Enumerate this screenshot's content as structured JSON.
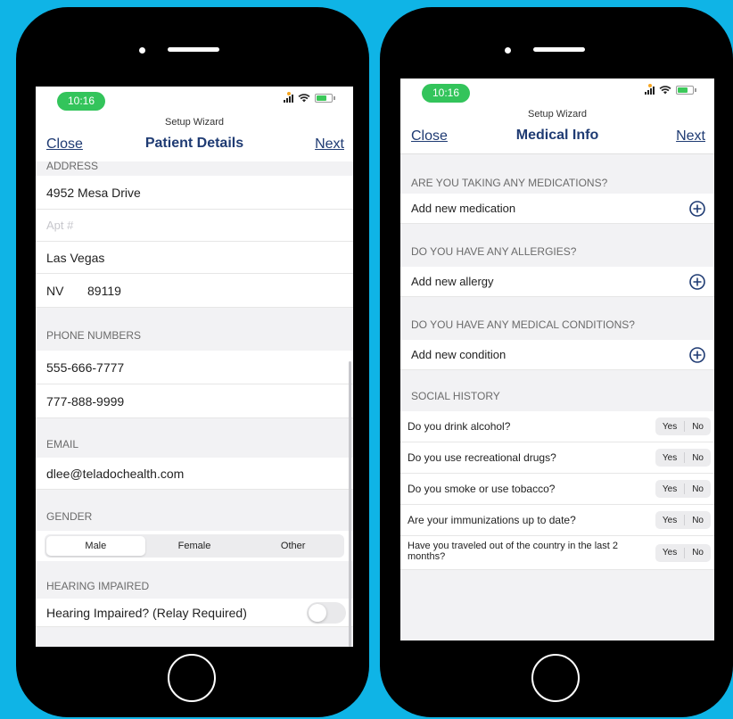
{
  "left": {
    "status": {
      "time": "10:16"
    },
    "wizard_title": "Setup Wizard",
    "nav": {
      "close": "Close",
      "title": "Patient Details",
      "next": "Next"
    },
    "address": {
      "header": "ADDRESS",
      "street": "4952 Mesa Drive",
      "apt_placeholder": "Apt #",
      "city": "Las Vegas",
      "state": "NV",
      "zip": "89119"
    },
    "phones": {
      "header": "PHONE NUMBERS",
      "items": [
        "555-666-7777",
        "777-888-9999"
      ]
    },
    "email": {
      "header": "EMAIL",
      "value": "dlee@teladochealth.com"
    },
    "gender": {
      "header": "GENDER",
      "options": [
        "Male",
        "Female",
        "Other"
      ],
      "selected": "Male"
    },
    "hearing": {
      "header": "HEARING IMPAIRED",
      "label": "Hearing Impaired? (Relay Required)",
      "on": false
    }
  },
  "right": {
    "status": {
      "time": "10:16"
    },
    "wizard_title": "Setup Wizard",
    "nav": {
      "close": "Close",
      "title": "Medical Info",
      "next": "Next"
    },
    "medications": {
      "header": "ARE YOU TAKING ANY MEDICATIONS?",
      "add": "Add new medication"
    },
    "allergies": {
      "header": "DO YOU HAVE ANY ALLERGIES?",
      "add": "Add new allergy"
    },
    "conditions": {
      "header": "DO YOU HAVE ANY MEDICAL CONDITIONS?",
      "add": "Add new condition"
    },
    "social": {
      "header": "SOCIAL HISTORY",
      "yes": "Yes",
      "no": "No",
      "questions": [
        "Do you drink alcohol?",
        "Do you use recreational drugs?",
        "Do you smoke or use tobacco?",
        "Are your immunizations up to date?",
        "Have you traveled out of the country in the last 2 months?"
      ]
    }
  },
  "colors": {
    "background": "#0fb4e6",
    "accent": "#1f3b73",
    "time_pill": "#33c45b"
  }
}
